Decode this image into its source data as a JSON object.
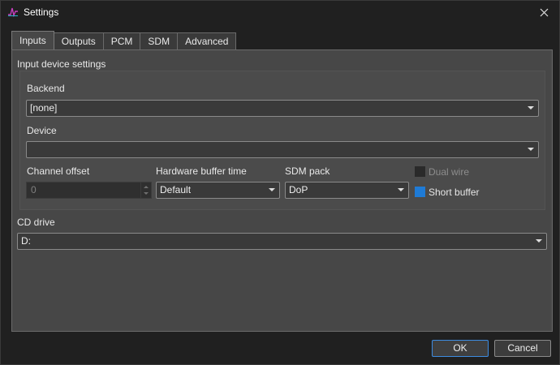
{
  "window": {
    "title": "Settings",
    "icon": "app-logo-icon",
    "close_icon": "close-icon"
  },
  "tabs": [
    {
      "label": "Inputs",
      "active": true
    },
    {
      "label": "Outputs",
      "active": false
    },
    {
      "label": "PCM",
      "active": false
    },
    {
      "label": "SDM",
      "active": false
    },
    {
      "label": "Advanced",
      "active": false
    }
  ],
  "input_device": {
    "section_label": "Input device settings",
    "backend": {
      "label": "Backend",
      "value": "[none]"
    },
    "device": {
      "label": "Device",
      "value": ""
    },
    "channel_offset": {
      "label": "Channel offset",
      "value": "0"
    },
    "hw_buffer_time": {
      "label": "Hardware buffer time",
      "value": "Default"
    },
    "sdm_pack": {
      "label": "SDM pack",
      "value": "DoP"
    },
    "dual_wire": {
      "label": "Dual wire",
      "checked": false,
      "enabled": false
    },
    "short_buffer": {
      "label": "Short buffer",
      "checked": true,
      "enabled": true
    }
  },
  "cd_drive": {
    "label": "CD drive",
    "value": "D:"
  },
  "footer": {
    "ok_label": "OK",
    "cancel_label": "Cancel"
  },
  "colors": {
    "accent": "#1f7bd6",
    "focus_border": "#3d8be0"
  }
}
